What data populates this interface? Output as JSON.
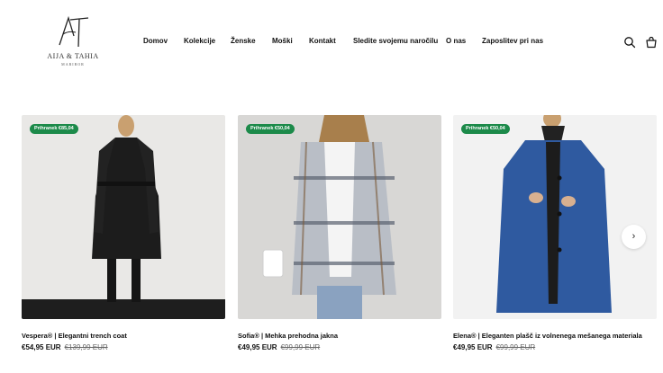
{
  "brand": {
    "name": "AIJA & TAHIA",
    "city": "MARIBOR",
    "monogram": "AT"
  },
  "nav": {
    "items": [
      {
        "label": "Domov"
      },
      {
        "label": "Kolekcije"
      },
      {
        "label": "Ženske"
      },
      {
        "label": "Moški"
      },
      {
        "label": "Kontakt"
      },
      {
        "label": "Sledite svojemu naročilu"
      },
      {
        "label": "O nas"
      },
      {
        "label": "Zaposlitev pri nas"
      }
    ]
  },
  "header_icons": [
    "search-icon",
    "cart-icon"
  ],
  "products": [
    {
      "badge": "Prihranek €85,04",
      "title": "Vespera® | Elegantni trench coat",
      "price": "€54,95 EUR",
      "original_price": "€139,99 EUR",
      "image": "woman-black-trench-coat",
      "image_color": "#1c1c1c"
    },
    {
      "badge": "Prihranek €50,04",
      "title": "Sofia® | Mehka prehodna jakna",
      "price": "€49,95 EUR",
      "original_price": "€99,99 EUR",
      "image": "woman-plaid-hooded-jacket",
      "image_color": "#a8aeb6"
    },
    {
      "badge": "Prihranek €50,04",
      "title": "Elena® | Eleganten plašč iz volnenega mešanega materiala",
      "price": "€49,95 EUR",
      "original_price": "€99,99 EUR",
      "image": "woman-blue-wool-coat",
      "image_color": "#2f5aa0"
    }
  ],
  "carousel": {
    "next_icon": "chevron-right-icon",
    "next_glyph": "›"
  },
  "colors": {
    "badge": "#1c8a4a",
    "text": "#111111",
    "background": "#ffffff"
  }
}
